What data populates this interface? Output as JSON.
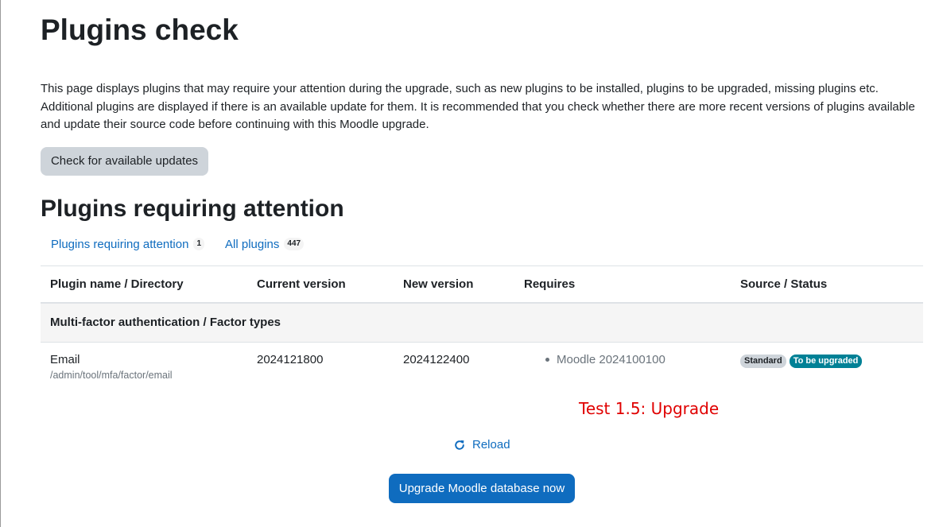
{
  "page": {
    "title": "Plugins check",
    "intro_line1": "This page displays plugins that may require your attention during the upgrade, such as new plugins to be installed, plugins to be upgraded, missing plugins etc.",
    "intro_line2": "Additional plugins are displayed if there is an available update for them. It is recommended that you check whether there are more recent versions of plugins available",
    "intro_line3": "and update their source code before continuing with this Moodle upgrade.",
    "check_updates_label": "Check for available updates",
    "section_title": "Plugins requiring attention"
  },
  "tabs": [
    {
      "label": "Plugins requiring attention",
      "count": "1"
    },
    {
      "label": "All plugins",
      "count": "447"
    }
  ],
  "table": {
    "headers": [
      "Plugin name / Directory",
      "Current version",
      "New version",
      "Requires",
      "Source / Status"
    ],
    "group": "Multi-factor authentication / Factor types",
    "row": {
      "name": "Email",
      "directory": "/admin/tool/mfa/factor/email",
      "current_version": "2024121800",
      "new_version": "2024122400",
      "requires": "Moodle 2024100100",
      "source_badge": "Standard",
      "status_badge": "To be upgraded"
    }
  },
  "test_label": "Test 1.5: Upgrade",
  "reload_label": "Reload",
  "upgrade_label": "Upgrade Moodle database now",
  "colors": {
    "link": "#0f6cbf",
    "primary": "#0f6cbf",
    "badge_info": "#008196",
    "test_label": "#e00000"
  },
  "icons": {
    "reload": "reload-icon"
  }
}
